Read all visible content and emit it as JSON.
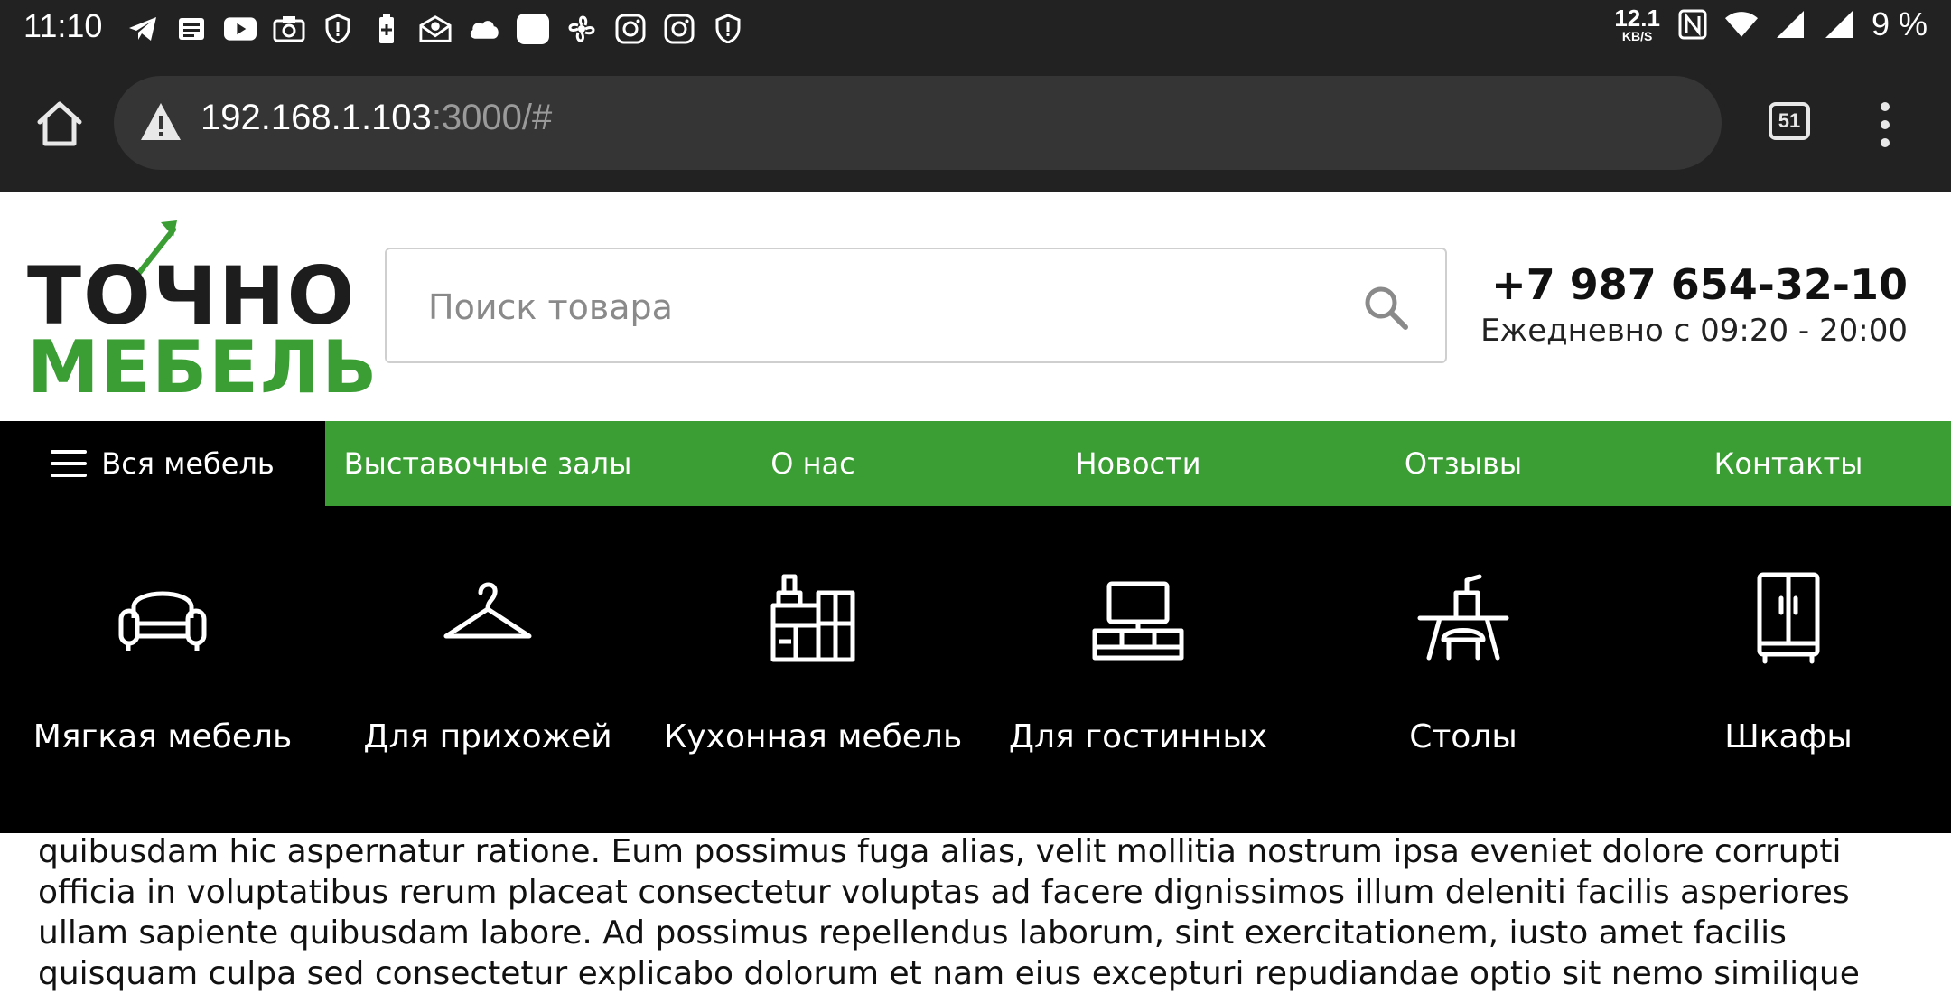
{
  "status_bar": {
    "time": "11:10",
    "left_icons": [
      "telegram-icon",
      "news-icon",
      "youtube-icon",
      "camera-icon",
      "shield-icon",
      "battery-plus-icon",
      "mail-icon",
      "cloud-icon",
      "app-square-icon",
      "fan-icon",
      "instagram-icon",
      "instagram-icon",
      "shield-icon"
    ],
    "speed_value": "12.1",
    "speed_unit": "KB/S",
    "battery": "9 %"
  },
  "browser": {
    "url_host": "192.168.1.103",
    "url_rest": ":3000/#",
    "tab_count": "51"
  },
  "header": {
    "logo_top": "ТОЧНО",
    "logo_bottom": "МЕБЕЛЬ",
    "search_placeholder": "Поиск товара",
    "phone": "+7 987 654-32-10",
    "hours": "Ежедневно с 09:20 - 20:00"
  },
  "nav": {
    "all_label": "Вся мебель",
    "items": [
      "Выставочные залы",
      "О нас",
      "Новости",
      "Отзывы",
      "Контакты"
    ]
  },
  "categories": [
    {
      "label": "Мягкая мебель",
      "icon": "sofa-icon"
    },
    {
      "label": "Для прихожей",
      "icon": "hanger-icon"
    },
    {
      "label": "Кухонная мебель",
      "icon": "kitchen-icon"
    },
    {
      "label": "Для гостинных",
      "icon": "tv-stand-icon"
    },
    {
      "label": "Столы",
      "icon": "desk-icon"
    },
    {
      "label": "Шкафы",
      "icon": "wardrobe-icon"
    }
  ],
  "content": {
    "text": "quibusdam hic aspernatur ratione. Eum possimus fuga alias, velit mollitia nostrum ipsa eveniet dolore corrupti officia in voluptatibus rerum placeat consectetur voluptas ad facere dignissimos illum deleniti facilis asperiores ullam sapiente quibusdam labore. Ad possimus repellendus laborum, sint exercitationem, iusto amet facilis quisquam culpa sed consectetur explicabo dolorum et nam eius excepturi repudiandae optio sit nemo similique"
  },
  "colors": {
    "brand_green": "#3a9e34",
    "dark": "#222222"
  }
}
